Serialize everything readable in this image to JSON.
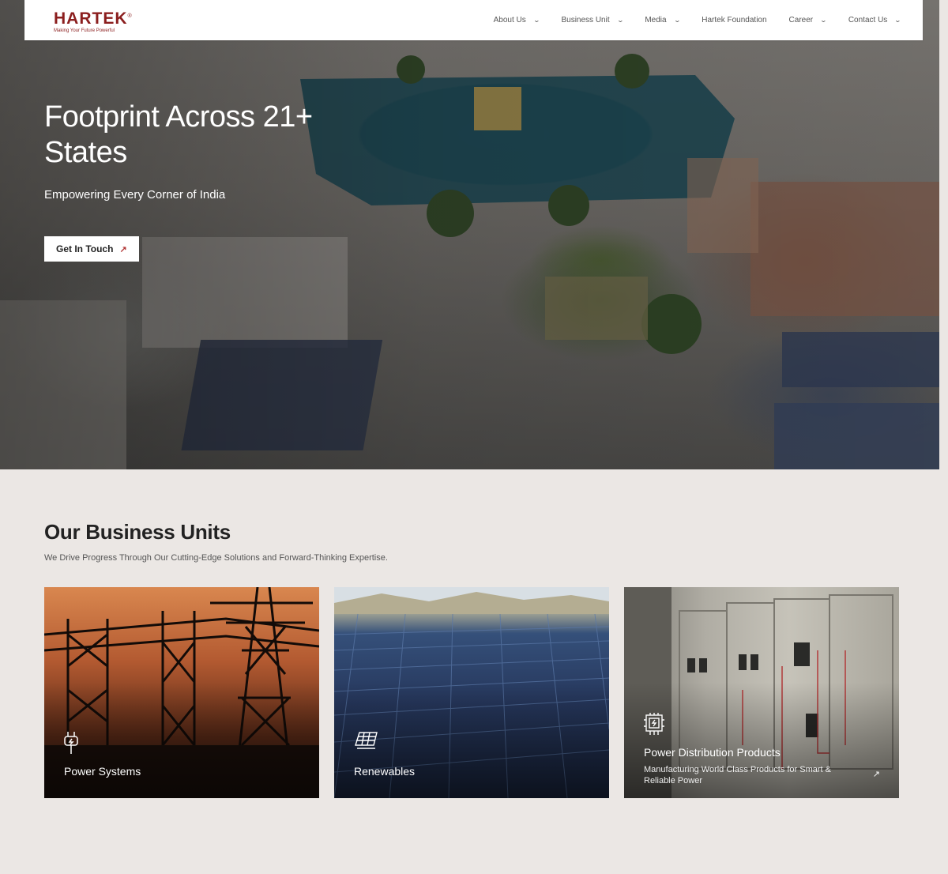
{
  "brand": {
    "name": "HARTEK",
    "registered": "®",
    "tagline": "Making Your Future Powerful"
  },
  "nav": {
    "items": [
      {
        "label": "About Us",
        "has_dropdown": true
      },
      {
        "label": "Business Unit",
        "has_dropdown": true
      },
      {
        "label": "Media",
        "has_dropdown": true
      },
      {
        "label": "Hartek Foundation",
        "has_dropdown": false
      },
      {
        "label": "Career",
        "has_dropdown": true
      },
      {
        "label": "Contact Us",
        "has_dropdown": true
      }
    ]
  },
  "hero": {
    "title_line1": "Footprint Across 21+",
    "title_line2": "States",
    "subtitle": "Empowering Every Corner of India",
    "cta_label": "Get In Touch"
  },
  "business_units": {
    "title": "Our Business Units",
    "subtitle": "We Drive Progress Through Our Cutting-Edge Solutions and Forward-Thinking Expertise.",
    "cards": [
      {
        "label": "Power Systems",
        "icon": "plug-icon"
      },
      {
        "label": "Renewables",
        "icon": "solar-panel-icon"
      },
      {
        "label": "Power Distribution Products",
        "icon": "circuit-board-icon",
        "description": "Manufacturing World Class Products for Smart & Reliable Power"
      }
    ]
  },
  "colors": {
    "brand_red": "#8b1e1e",
    "page_bg": "#ebe7e4",
    "header_bg": "#ffffff"
  }
}
